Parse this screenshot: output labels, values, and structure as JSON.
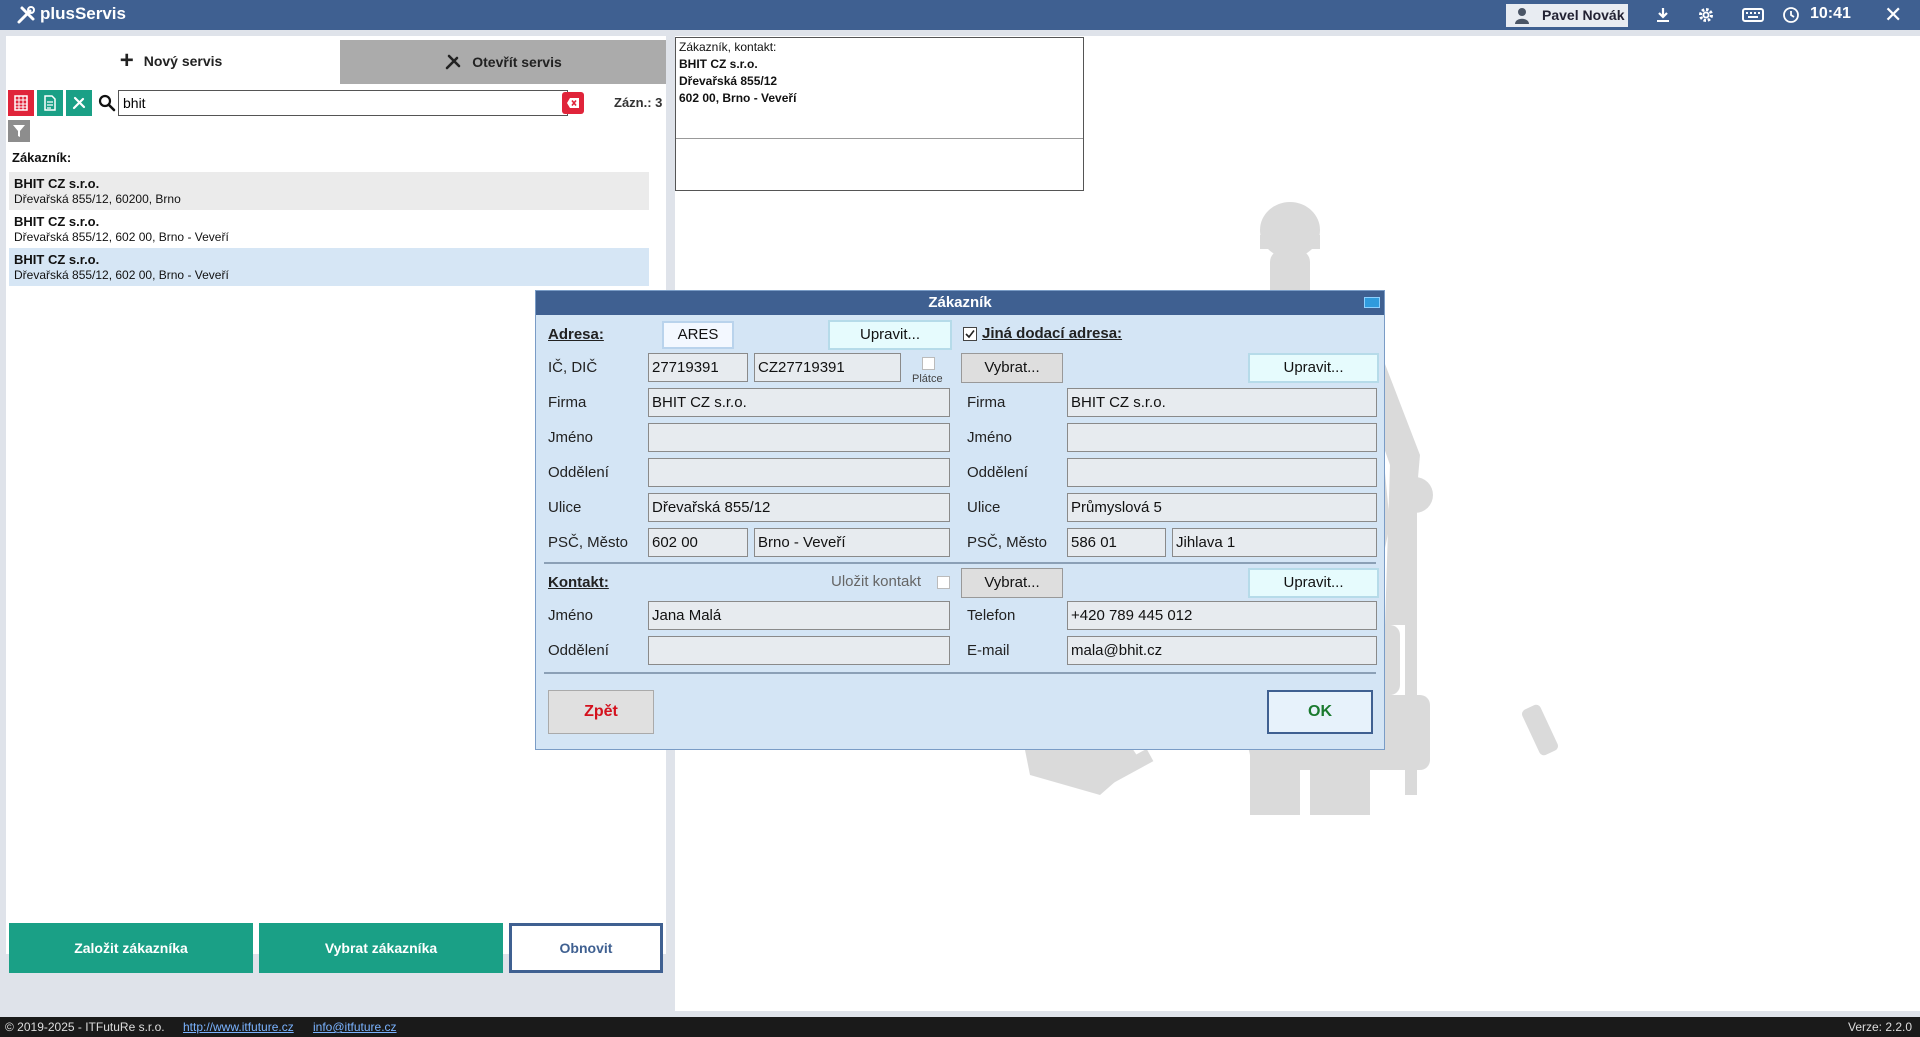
{
  "app": {
    "title": "plusServis",
    "user": "Pavel Novák",
    "clock": "10:41"
  },
  "left": {
    "tab_new": "Nový servis",
    "tab_open": "Otevřít servis",
    "search_value": "bhit",
    "record_count": "Zázn.: 3",
    "customer_label": "Zákazník:",
    "customers": [
      {
        "name": "BHIT CZ s.r.o.",
        "address": "Dřevařská 855/12, 60200, Brno"
      },
      {
        "name": "BHIT CZ s.r.o.",
        "address": "Dřevařská 855/12, 602 00, Brno - Veveří"
      },
      {
        "name": "BHIT CZ s.r.o.",
        "address": "Dřevařská 855/12, 602 00, Brno - Veveří"
      }
    ],
    "btn_create": "Založit zákazníka",
    "btn_select": "Vybrat zákazníka",
    "btn_refresh": "Obnovit"
  },
  "contact_box": {
    "label": "Zákazník, kontakt:",
    "name": "BHIT CZ s.r.o.",
    "street": "Dřevařská 855/12",
    "city": "602 00, Brno - Veveří"
  },
  "dialog": {
    "title": "Zákazník",
    "address_label": "Adresa:",
    "ares": "ARES",
    "edit": "Upravit...",
    "other_delivery": "Jiná dodací adresa:",
    "select": "Vybrat...",
    "payer": "Plátce",
    "labels": {
      "ic_dic": "IČ, DIČ",
      "firma": "Firma",
      "jmeno": "Jméno",
      "oddeleni": "Oddělení",
      "ulice": "Ulice",
      "psc_mesto": "PSČ, Město",
      "kontakt": "Kontakt:",
      "save_contact": "Uložit kontakt",
      "telefon": "Telefon",
      "email": "E-mail"
    },
    "billing": {
      "ic": "27719391",
      "dic": "CZ27719391",
      "firma": "BHIT CZ s.r.o.",
      "jmeno": "",
      "oddeleni": "",
      "ulice": "Dřevařská 855/12",
      "psc": "602 00",
      "mesto": "Brno - Veveří"
    },
    "delivery": {
      "firma": "BHIT CZ s.r.o.",
      "jmeno": "",
      "oddeleni": "",
      "ulice": "Průmyslová 5",
      "psc": "586 01",
      "mesto": "Jihlava 1"
    },
    "contact": {
      "jmeno": "Jana Malá",
      "oddeleni": "",
      "telefon": "+420 789 445 012",
      "email": "mala@bhit.cz"
    },
    "btn_back": "Zpět",
    "btn_ok": "OK"
  },
  "footer": {
    "copyright": "© 2019-2025 - ITFutuRe s.r.o.",
    "web": "http://www.itfuture.cz",
    "mail": "info@itfuture.cz",
    "version": "Verze: 2.2.0"
  }
}
